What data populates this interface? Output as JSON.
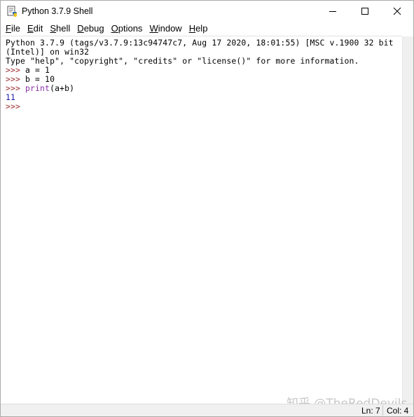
{
  "window": {
    "title": "Python 3.7.9 Shell",
    "icon": "python-idle-icon"
  },
  "menu": [
    {
      "label": "File",
      "accel": "F",
      "rest": "ile"
    },
    {
      "label": "Edit",
      "accel": "E",
      "rest": "dit"
    },
    {
      "label": "Shell",
      "accel": "S",
      "rest": "hell"
    },
    {
      "label": "Debug",
      "accel": "D",
      "rest": "ebug"
    },
    {
      "label": "Options",
      "accel": "O",
      "rest": "ptions"
    },
    {
      "label": "Window",
      "accel": "W",
      "rest": "indow"
    },
    {
      "label": "Help",
      "accel": "H",
      "rest": "elp"
    }
  ],
  "shell": {
    "banner1": "Python 3.7.9 (tags/v3.7.9:13c94747c7, Aug 17 2020, 18:01:55) [MSC v.1900 32 bit",
    "banner2": "(Intel)] on win32",
    "banner3": "Type \"help\", \"copyright\", \"credits\" or \"license()\" for more information.",
    "prompt": ">>> ",
    "cmd1": "a = 1",
    "cmd2": "b = 10",
    "cmd3_builtin": "print",
    "cmd3_rest": "(a+b)",
    "output": "11",
    "final_prompt": ">>>"
  },
  "status": {
    "ln": "Ln: 7",
    "col": "Col: 4"
  },
  "watermark": "知乎 @TheRedDevils",
  "colors": {
    "prompt": "#9b2b2b",
    "builtin": "#8b2fa8",
    "stdout": "#1a1ab0"
  }
}
